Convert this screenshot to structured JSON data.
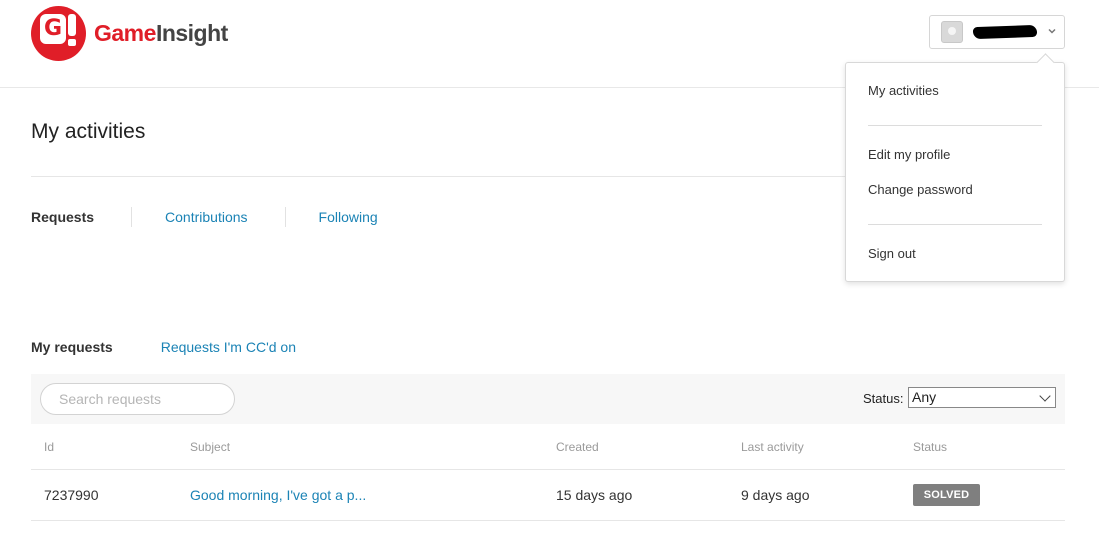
{
  "brand": {
    "name_part1": "Game",
    "name_part2": "Insight",
    "mark_letter": "G"
  },
  "user_menu": {
    "items": {
      "activities": "My activities",
      "edit_profile": "Edit my profile",
      "change_password": "Change password",
      "sign_out": "Sign out"
    }
  },
  "page": {
    "title": "My activities"
  },
  "tabs": [
    {
      "label": "Requests",
      "active": true
    },
    {
      "label": "Contributions",
      "active": false
    },
    {
      "label": "Following",
      "active": false
    }
  ],
  "subtabs": [
    {
      "label": "My requests",
      "active": true
    },
    {
      "label": "Requests I'm CC'd on",
      "active": false
    }
  ],
  "filters": {
    "search_placeholder": "Search requests",
    "status_label": "Status:",
    "status_value": "Any"
  },
  "table": {
    "columns": [
      "Id",
      "Subject",
      "Created",
      "Last activity",
      "Status"
    ],
    "rows": [
      {
        "id": "7237990",
        "subject": "Good morning, I've got a p...",
        "created": "15 days ago",
        "last_activity": "9 days ago",
        "status": "SOLVED"
      }
    ]
  },
  "colors": {
    "accent": "#1b83b5",
    "brand_red": "#e01e28",
    "badge_gray": "#7f7f7f"
  }
}
